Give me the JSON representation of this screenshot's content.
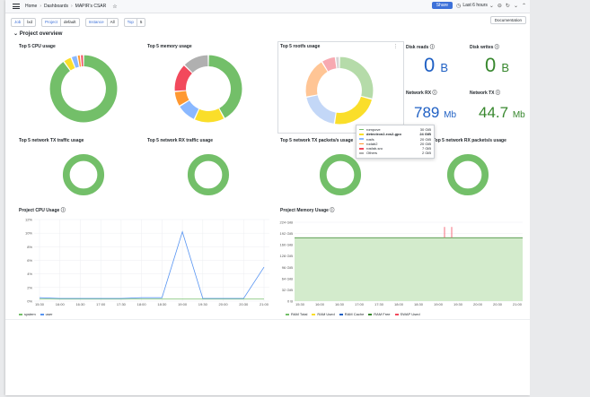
{
  "topbar": {
    "crumbs": [
      "Home",
      "Dashboards",
      "MAPIR's CSAR"
    ],
    "share_label": "Share",
    "time_range": "Last 6 hours"
  },
  "variables": [
    {
      "label": "Job",
      "value": "lxd"
    },
    {
      "label": "Project",
      "value": "default"
    },
    {
      "label": "Instance",
      "value": "All"
    },
    {
      "label": "Top",
      "value": "5"
    }
  ],
  "documentation_label": "Documentation",
  "section_title": "Project overview",
  "panels": {
    "cpu": "Top 5 CPU usage",
    "memory": "Top 5 memory usage",
    "rootfs": "Top 5 rootfs usage",
    "disk_reads": "Disk reads",
    "disk_writes": "Disk writes",
    "net_rx": "Network RX",
    "net_tx": "Network TX",
    "tx_traffic": "Top 5 network TX traffic usage",
    "rx_traffic": "Top 5 network RX traffic usage",
    "tx_packets": "Top 5 network TX packets/s usage",
    "rx_packets": "Top 5 network RX packets/s usage",
    "project_cpu": "Project CPU Usage",
    "project_mem": "Project Memory Usage"
  },
  "stats": {
    "disk_reads": {
      "value": "0",
      "unit": "B"
    },
    "disk_writes": {
      "value": "0",
      "unit": "B"
    },
    "net_rx": {
      "value": "789",
      "unit": "Mb"
    },
    "net_tx": {
      "value": "44.7",
      "unit": "Mb"
    }
  },
  "tooltip": [
    {
      "name": "rompove",
      "value": "30 GiB",
      "color": "#73bf69"
    },
    {
      "name": "detectron2-ros2-gpo",
      "value": "24 GiB",
      "color": "#fade2a",
      "selected": true
    },
    {
      "name": "rosfs",
      "value": "20 GiB",
      "color": "#8ab8ff"
    },
    {
      "name": "rodab2",
      "value": "20 GiB",
      "color": "#ff9830"
    },
    {
      "name": "rosfab-sro",
      "value": "7 GiB",
      "color": "#f2495c"
    },
    {
      "name": "Others",
      "value": "2 GiB",
      "color": "#b0b0b0"
    }
  ],
  "cpu_axis": [
    "12%",
    "10%",
    "8%",
    "6%",
    "4%",
    "2%",
    "0%"
  ],
  "mem_axis": [
    "224 GiB",
    "192 GiB",
    "160 GiB",
    "128 GiB",
    "96 GiB",
    "64 GiB",
    "32 GiB",
    "0 B"
  ],
  "time_ticks": [
    "15:30",
    "16:00",
    "16:30",
    "17:00",
    "17:30",
    "18:00",
    "18:30",
    "19:00",
    "19:30",
    "20:00",
    "20:30",
    "21:00"
  ],
  "cpu_legend": [
    {
      "name": "system",
      "color": "#73bf69"
    },
    {
      "name": "user",
      "color": "#5794f2"
    }
  ],
  "mem_legend": [
    {
      "name": "RAM Total",
      "color": "#73bf69"
    },
    {
      "name": "RAM Used",
      "color": "#fade2a"
    },
    {
      "name": "RAM Cache",
      "color": "#1f60c4"
    },
    {
      "name": "RAM Free",
      "color": "#37872d"
    },
    {
      "name": "SWAP Used",
      "color": "#f2495c"
    }
  ],
  "donuts": {
    "cpu": [
      {
        "v": 90,
        "c": "#73bf69"
      },
      {
        "v": 4,
        "c": "#fade2a"
      },
      {
        "v": 3,
        "c": "#8ab8ff"
      },
      {
        "v": 1.5,
        "c": "#ff9830"
      },
      {
        "v": 1.5,
        "c": "#f2495c"
      }
    ],
    "memory": [
      {
        "v": 40,
        "c": "#73bf69"
      },
      {
        "v": 14,
        "c": "#fade2a"
      },
      {
        "v": 9,
        "c": "#8ab8ff"
      },
      {
        "v": 7,
        "c": "#ff9830"
      },
      {
        "v": 13,
        "c": "#f2495c"
      },
      {
        "v": 12,
        "c": "#b0b0b0"
      }
    ],
    "rootfs": [
      {
        "v": 30,
        "c": "#b5dba9"
      },
      {
        "v": 24,
        "c": "#fade2a"
      },
      {
        "v": 20,
        "c": "#c3d7f7"
      },
      {
        "v": 20,
        "c": "#ffc595"
      },
      {
        "v": 7,
        "c": "#f7a9b1"
      },
      {
        "v": 2,
        "c": "#d5d5d5"
      }
    ],
    "tx_traffic": [
      {
        "v": 100,
        "c": "#73bf69"
      }
    ],
    "rx_traffic": [
      {
        "v": 100,
        "c": "#73bf69"
      }
    ],
    "tx_packets": [
      {
        "v": 100,
        "c": "#73bf69"
      }
    ],
    "rx_packets": [
      {
        "v": 100,
        "c": "#73bf69"
      }
    ]
  },
  "chart_data": [
    {
      "type": "line",
      "title": "Project CPU Usage",
      "ylim": [
        0,
        12
      ],
      "x": [
        "15:30",
        "16:00",
        "16:30",
        "17:00",
        "17:30",
        "18:00",
        "18:30",
        "19:00",
        "19:30",
        "20:00",
        "20:30",
        "21:00"
      ],
      "series": [
        {
          "name": "system",
          "values": [
            0.3,
            0.3,
            0.3,
            0.3,
            0.3,
            0.3,
            0.3,
            0.3,
            0.3,
            0.3,
            0.3,
            0.3
          ]
        },
        {
          "name": "user",
          "values": [
            0.5,
            0.4,
            0.4,
            0.4,
            0.4,
            0.5,
            0.5,
            10.2,
            0.4,
            0.4,
            0.4,
            5.0
          ]
        }
      ]
    },
    {
      "type": "area",
      "title": "Project Memory Usage",
      "ylim": [
        0,
        224
      ],
      "x": [
        "15:30",
        "16:00",
        "16:30",
        "17:00",
        "17:30",
        "18:00",
        "18:30",
        "19:00",
        "19:30",
        "20:00",
        "20:30",
        "21:00"
      ],
      "series": [
        {
          "name": "RAM Total",
          "values": [
            180,
            180,
            180,
            180,
            180,
            180,
            180,
            180,
            180,
            180,
            180,
            180
          ]
        },
        {
          "name": "RAM Used",
          "values": [
            180,
            180,
            180,
            180,
            180,
            180,
            180,
            180,
            180,
            180,
            180,
            180
          ]
        },
        {
          "name": "SWAP Used",
          "values": [
            0,
            0,
            0,
            0,
            0,
            0,
            0,
            0,
            0,
            0,
            0,
            0
          ]
        }
      ]
    }
  ]
}
